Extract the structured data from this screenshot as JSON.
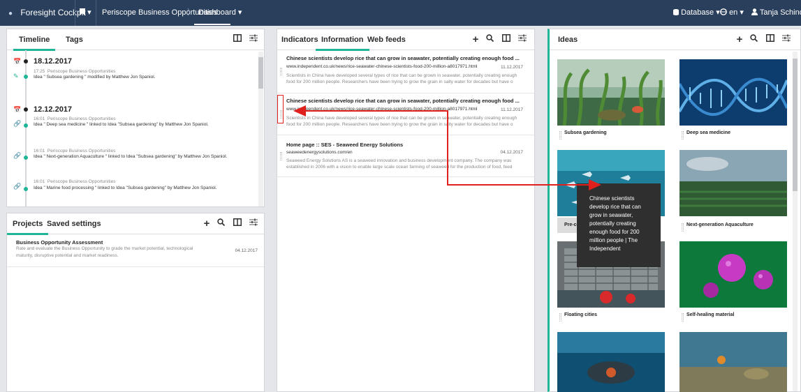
{
  "topbar": {
    "brand": "Foresight Cockpit",
    "bookmark": "▾",
    "crumb1": "Periscope Business Opportunities",
    "crumb_sep": "〉",
    "crumb2": "Dashboard ▾",
    "database": "Database ▾",
    "lang": "en ▾",
    "user": "Tanja Schindler ▾"
  },
  "timeline_panel": {
    "tabs": [
      "Timeline",
      "Tags"
    ],
    "groups": [
      {
        "date": "18.12.2017",
        "entries": [
          {
            "time": "17:25",
            "source": "Periscope Business Opportunities",
            "text": "Idea \" Subsea gardening \" modified by Matthew Jon Spaniol."
          }
        ]
      },
      {
        "date": "12.12.2017",
        "entries": [
          {
            "time": "16:01",
            "source": "Periscope Business Opportunities",
            "text": "Idea \" Deep sea medicine \" linked to Idea \"Subsea gardening\" by Matthew Jon Spaniol."
          },
          {
            "time": "16:01",
            "source": "Periscope Business Opportunities",
            "text": "Idea \" Next-generation Aquaculture \" linked to Idea \"Subsea gardening\" by Matthew Jon Spaniol."
          },
          {
            "time": "16:01",
            "source": "Periscope Business Opportunities",
            "text": "Idea \" Marine food processing \" linked to Idea \"Subsea gardening\" by Matthew Jon Spaniol."
          }
        ]
      }
    ]
  },
  "projects_panel": {
    "tabs": [
      "Projects",
      "Saved settings"
    ],
    "items": [
      {
        "title": "Business Opportunity Assessment",
        "desc1": "Rate and evaluate the Business Opportunity to grade the market potential, technological",
        "desc2": "maturity, disruptive potential and market readiness.",
        "date": "04.12.2017"
      }
    ]
  },
  "info_panel": {
    "tabs": [
      "Indicators",
      "Information",
      "Web feeds"
    ],
    "items": [
      {
        "title": "Chinese scientists develop rice that can grow in seawater, potentially creating enough food ...",
        "url": "www.independent.co.uk/news/rice-seawater-chinese-scientists-food-200-million-a8017971.html",
        "date": "11.12.2017",
        "body": "Scientists in China have developed several types of rice that can be grown in seawater, potentially creating enough food for 200 million people. Researchers have been trying to grow the grain in salty water for decades but have o"
      },
      {
        "title": "Chinese scientists develop rice that can grow in seawater, potentially creating enough food ...",
        "url": "www.independent.co.uk/news/rice-seawater-chinese-scientists-food-200-million-a8017971.html",
        "date": "11.12.2017",
        "body": "Scientists in China have developed several types of rice that can be grown in seawater, potentially creating enough food for 200 million people. Researchers have been trying to grow the grain in salty water for decades but have o"
      },
      {
        "title": "Home page :: SES - Seaweed Energy Solutions",
        "url": "seaweedenergysolutions.com/en",
        "date": "04.12.2017",
        "body": "Seaweed Energy Solutions AS is a seaweed innovation and business development company.  The company was established in 2006 with a vision to enable large scale ocean farming of seaweed for the production of food, feed"
      }
    ]
  },
  "ideas_panel": {
    "title": "Ideas",
    "items": [
      "Subsea gardening",
      "Deep sea medicine",
      "Pre-con",
      "Next-generation Aquaculture",
      "Floating cities",
      "Self-healing material"
    ]
  },
  "tooltip": {
    "lines": [
      "Chinese scientists",
      "develop rice that can",
      "grow in seawater,",
      "potentially creating",
      "enough food for 200",
      "million people | The",
      "Independent"
    ]
  },
  "colors": {
    "topbar": "#2a3f5c",
    "accent": "#1fb597",
    "annotation": "#e0201c"
  }
}
